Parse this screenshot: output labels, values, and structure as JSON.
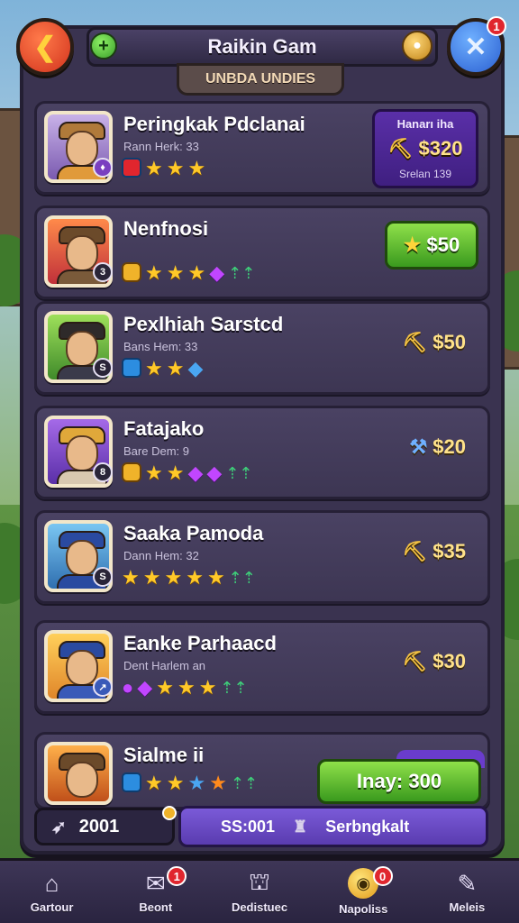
{
  "header": {
    "title": "Raikin Gam",
    "ribbon": "UNBDA UNDIES",
    "back_icon": "back-arrow-icon",
    "close_icon": "close-x-icon",
    "close_badge": "1",
    "plus_icon": "plus-icon",
    "coin_icon": "coin-icon"
  },
  "rows": [
    {
      "name": "Peringkak Pdclanai",
      "sub": "Rann Herk: 33",
      "level": "",
      "price": "$320",
      "highlight": {
        "top": "Hanarı iha",
        "bottom": "Srelan 139"
      }
    },
    {
      "name": "Nenfnosi",
      "sub": "",
      "level": "3",
      "price": "$50",
      "button": true
    },
    {
      "name": "Pexlhiah Sarstcd",
      "sub": "Bans Hem: 33",
      "level": "S",
      "price": "$50"
    },
    {
      "name": "Fatajako",
      "sub": "Bare Dem: 9",
      "level": "8",
      "price": "$20"
    },
    {
      "name": "Saaka Pamoda",
      "sub": "Dann Hem: 32",
      "level": "S",
      "price": "$35"
    },
    {
      "name": "Eanke Parhaacd",
      "sub": "Dent Harlem an",
      "level": "",
      "price": "$30"
    },
    {
      "name": "Sialme ii",
      "sub": "",
      "level": "",
      "price": ""
    }
  ],
  "buy_button": "Inay: 300",
  "bottom_bar": {
    "left_value": "2001",
    "mid_value": "SS:001",
    "right_label": "Serbngkalt"
  },
  "nav": [
    {
      "label": "Gartour",
      "icon": "home-icon",
      "badge": ""
    },
    {
      "label": "Beont",
      "icon": "chat-icon",
      "badge": "1"
    },
    {
      "label": "Dedistuec",
      "icon": "shop-icon",
      "badge": ""
    },
    {
      "label": "Napoliss",
      "icon": "coin-icon",
      "badge": "0"
    },
    {
      "label": "Meleis",
      "icon": "edit-icon",
      "badge": ""
    }
  ],
  "colors": {
    "panel": "#3a3350",
    "accent_green": "#3a9a1e",
    "accent_purple": "#5a2fa8",
    "gold": "#ffe28a"
  }
}
